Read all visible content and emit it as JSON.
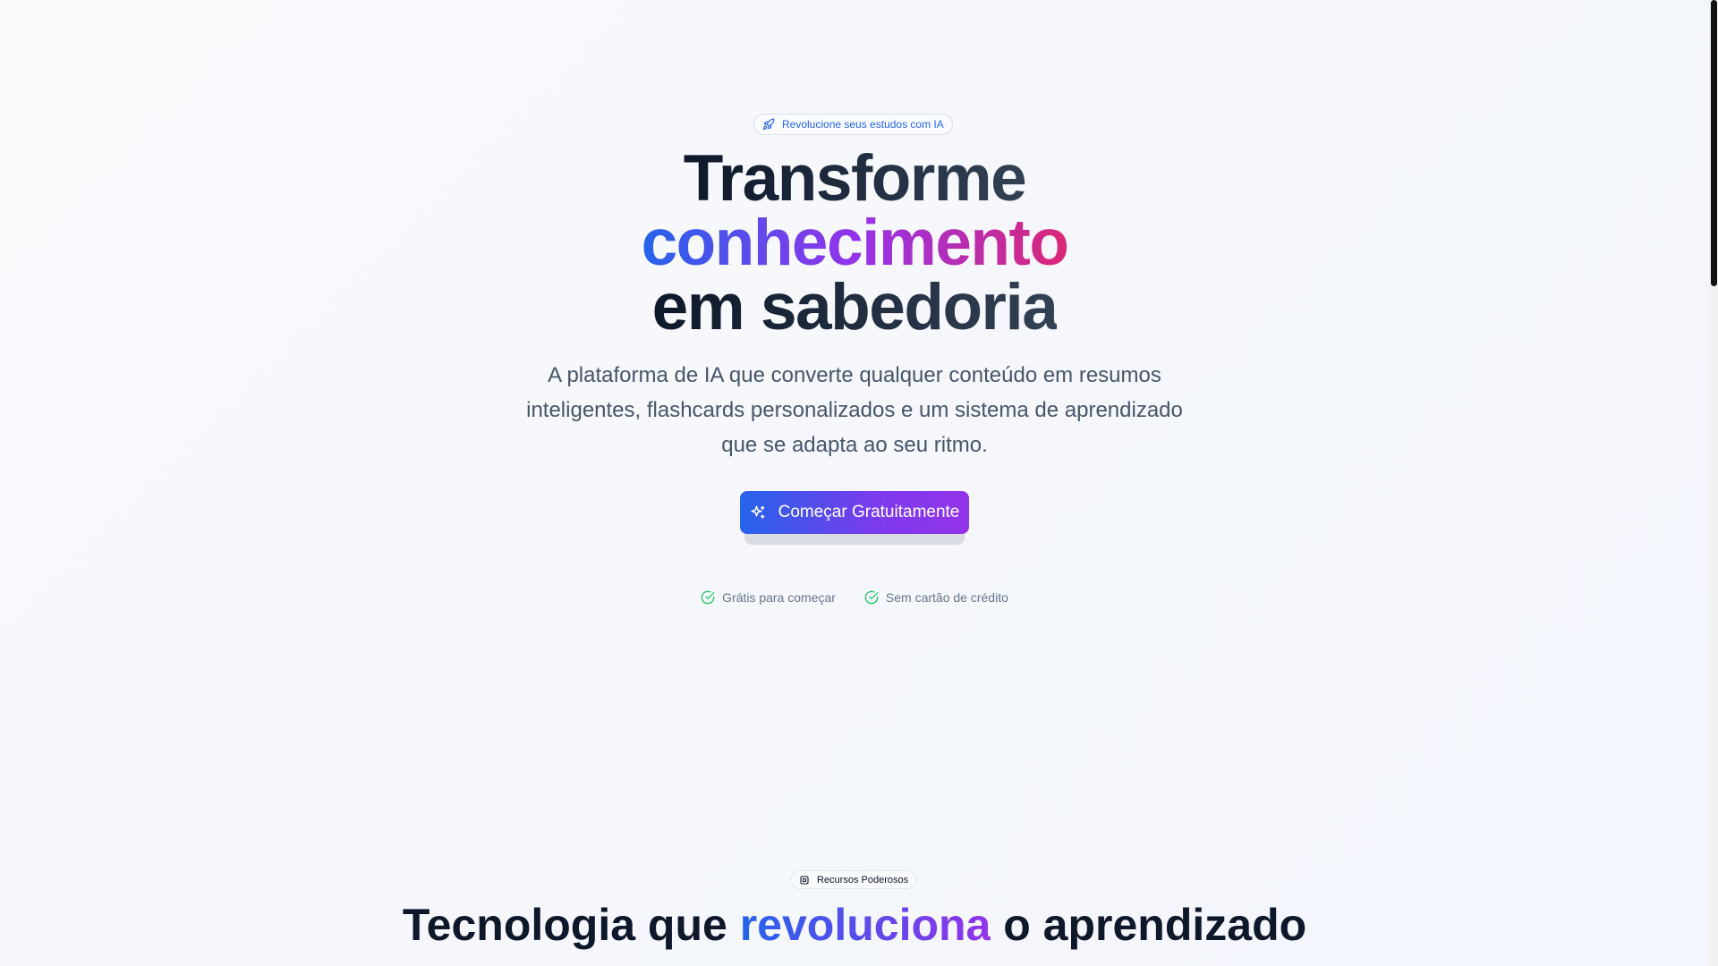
{
  "hero": {
    "badge_icon": "rocket-icon",
    "badge_text": "Revolucione seus estudos com IA",
    "headline_line1": "Transforme",
    "headline_line2": "conhecimento",
    "headline_line3": "em sabedoria",
    "subtitle": "A plataforma de IA que converte qualquer conteúdo em resumos inteligentes, flashcards personalizados e um sistema de aprendizado que se adapta ao seu ritmo.",
    "cta_icon": "sparkles-icon",
    "cta_label": "Começar Gratuitamente",
    "checks": [
      {
        "icon": "check-circle-icon",
        "label": "Grátis para começar"
      },
      {
        "icon": "check-circle-icon",
        "label": "Sem cartão de crédito"
      }
    ]
  },
  "features": {
    "badge_icon": "chip-icon",
    "badge_text": "Recursos Poderosos",
    "title_before": "Tecnologia que ",
    "title_highlight": "revoluciona",
    "title_after": " o aprendizado"
  },
  "colors": {
    "accent_blue": "#2563eb",
    "accent_purple": "#9333ea",
    "accent_pink": "#db2777",
    "check_green": "#22c55e",
    "text_dark": "#0f172a",
    "text_muted": "#475569"
  }
}
